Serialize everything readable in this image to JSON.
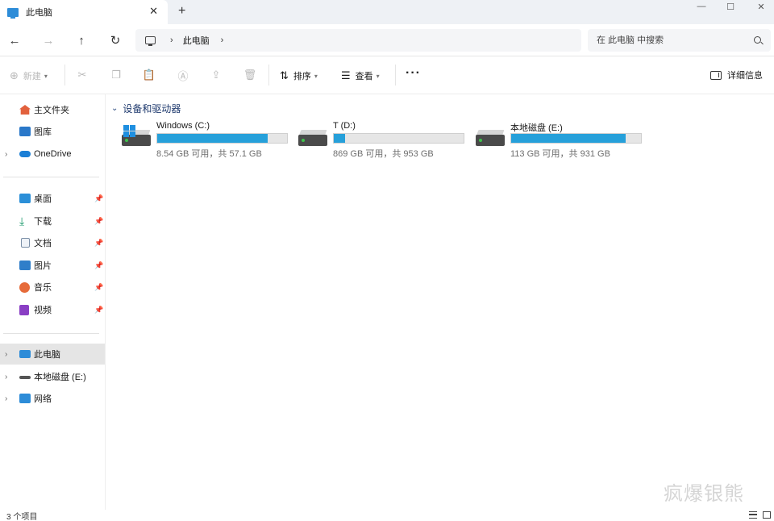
{
  "tab": {
    "title": "此电脑",
    "close": "✕",
    "new_tab": "+"
  },
  "window_controls": {
    "minimize": "—",
    "maximize": "☐",
    "close": "✕"
  },
  "nav": {
    "back": "←",
    "forward": "→",
    "up": "↑",
    "refresh": "↻"
  },
  "address": {
    "chevron": "›",
    "location": "此电脑",
    "trailing_chevron": "›"
  },
  "search": {
    "placeholder": "在 此电脑 中搜索"
  },
  "commands": {
    "new_label": "新建",
    "sort_label": "排序",
    "view_label": "查看",
    "more": "···",
    "details_label": "详细信息"
  },
  "sidebar": {
    "top": [
      {
        "label": "主文件夹",
        "icon": "home-icon",
        "color": "#e2613d"
      },
      {
        "label": "图库",
        "icon": "gallery-icon",
        "color": "#2a78c9"
      },
      {
        "label": "OneDrive",
        "icon": "cloud-icon",
        "color": "#1b7fd6",
        "expandable": true
      }
    ],
    "pinned": [
      {
        "label": "桌面",
        "icon": "desktop-folder-icon",
        "color": "#2b8fd8"
      },
      {
        "label": "下载",
        "icon": "download-icon",
        "color": "#1d9a6c"
      },
      {
        "label": "文档",
        "icon": "document-icon",
        "color": "#7a8ea6"
      },
      {
        "label": "图片",
        "icon": "pictures-icon",
        "color": "#2f7ec9"
      },
      {
        "label": "音乐",
        "icon": "music-icon",
        "color": "#e66b3a"
      },
      {
        "label": "视频",
        "icon": "video-icon",
        "color": "#8a3fc4"
      }
    ],
    "locations": [
      {
        "label": "此电脑",
        "icon": "computer-icon",
        "color": "#2d8cd8",
        "selected": true
      },
      {
        "label": "本地磁盘 (E:)",
        "icon": "drive-icon",
        "color": "#555555"
      },
      {
        "label": "网络",
        "icon": "network-icon",
        "color": "#2d8cd8"
      }
    ]
  },
  "group": {
    "title": "设备和驱动器"
  },
  "drives": [
    {
      "name": "Windows (C:)",
      "info": "8.54 GB 可用，共 57.1 GB",
      "used_fraction": 0.85,
      "os_drive": true
    },
    {
      "name": "T (D:)",
      "info": "869 GB 可用，共 953 GB",
      "used_fraction": 0.09,
      "os_drive": false
    },
    {
      "name": "本地磁盘 (E:)",
      "info": "113 GB 可用，共 931 GB",
      "used_fraction": 0.88,
      "os_drive": false
    }
  ],
  "status": {
    "items": "3 个项目"
  },
  "watermark": "疯爆银熊",
  "colors": {
    "accent": "#26a0da",
    "selected_bg": "#e5e5e5"
  }
}
